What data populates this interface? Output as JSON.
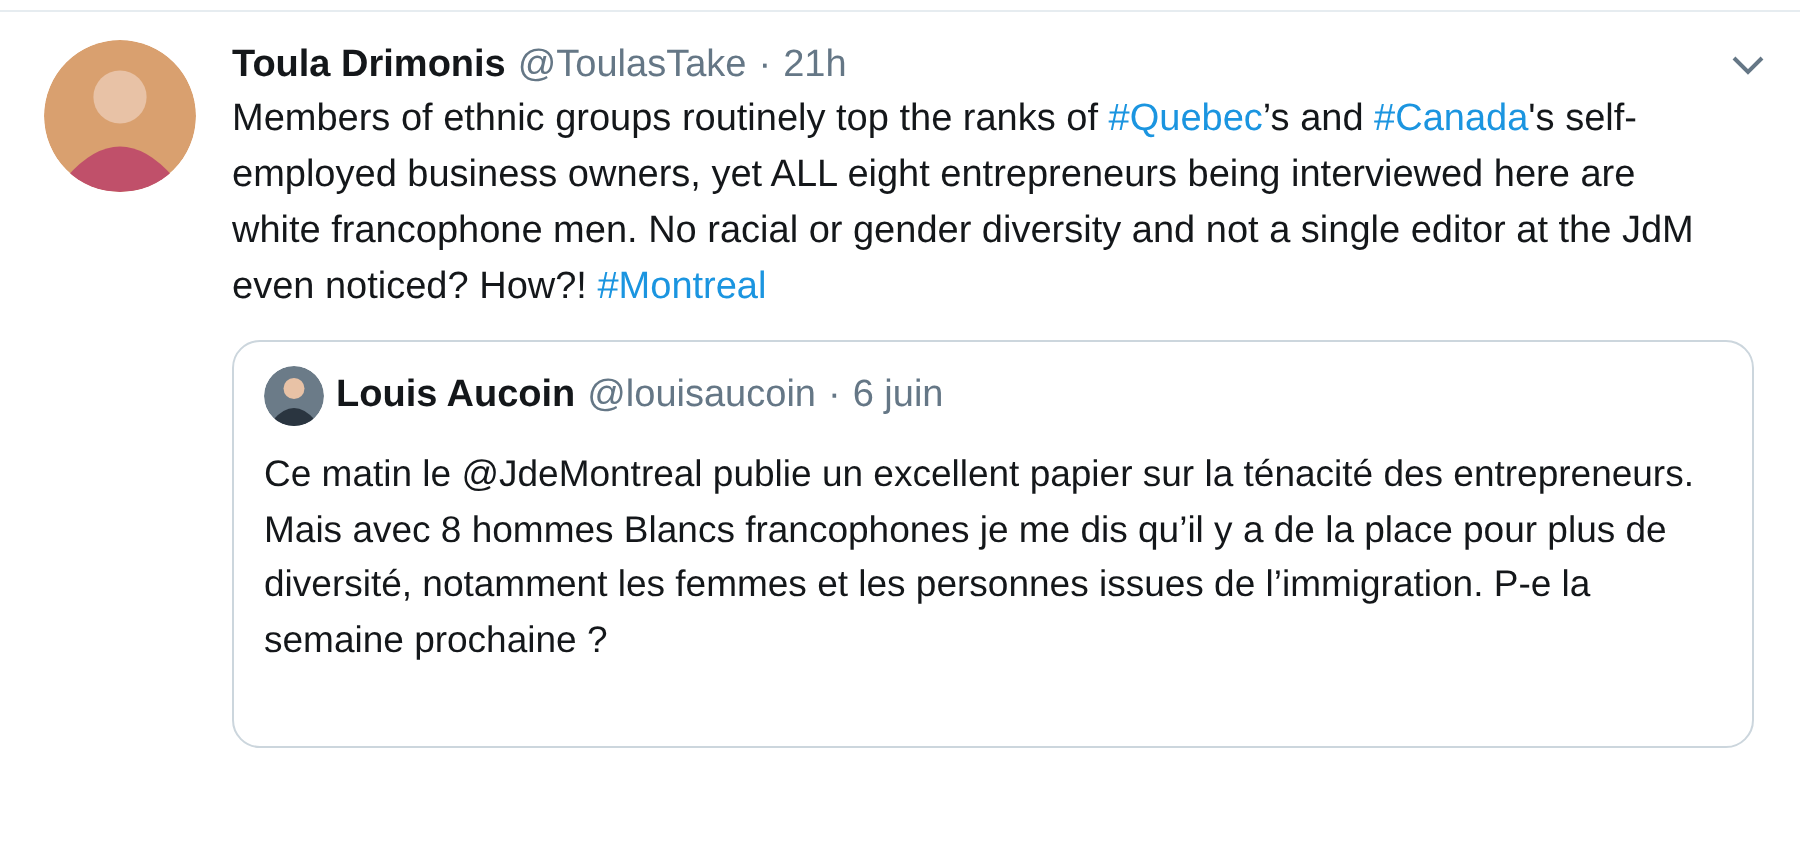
{
  "tweet": {
    "name": "Toula Drimonis",
    "handle": "@ToulasTake",
    "separator": "·",
    "time": "21h",
    "text": [
      {
        "kind": "text",
        "text": "Members of ethnic groups routinely top the ranks of "
      },
      {
        "kind": "hashtag",
        "text": "#Quebec"
      },
      {
        "kind": "text",
        "text": "’s and "
      },
      {
        "kind": "hashtag",
        "text": "#Canada"
      },
      {
        "kind": "text",
        "text": "'s self-employed business owners, yet ALL eight entrepreneurs being interviewed here are white francophone men. No racial or gender diversity and not a single editor at the JdM even noticed? How?! "
      },
      {
        "kind": "hashtag",
        "text": "#Montreal"
      }
    ],
    "quoted": {
      "name": "Louis Aucoin",
      "handle": "@louisaucoin",
      "separator": "·",
      "time": "6 juin",
      "text": "Ce matin le @JdeMontreal publie un excellent papier sur la ténacité des entrepreneurs. Mais avec 8 hommes Blancs francophones je me dis qu’il y a de la place pour plus de diversité, notamment les femmes et les personnes issues de l’immigration. P-e la semaine prochaine ?"
    }
  }
}
